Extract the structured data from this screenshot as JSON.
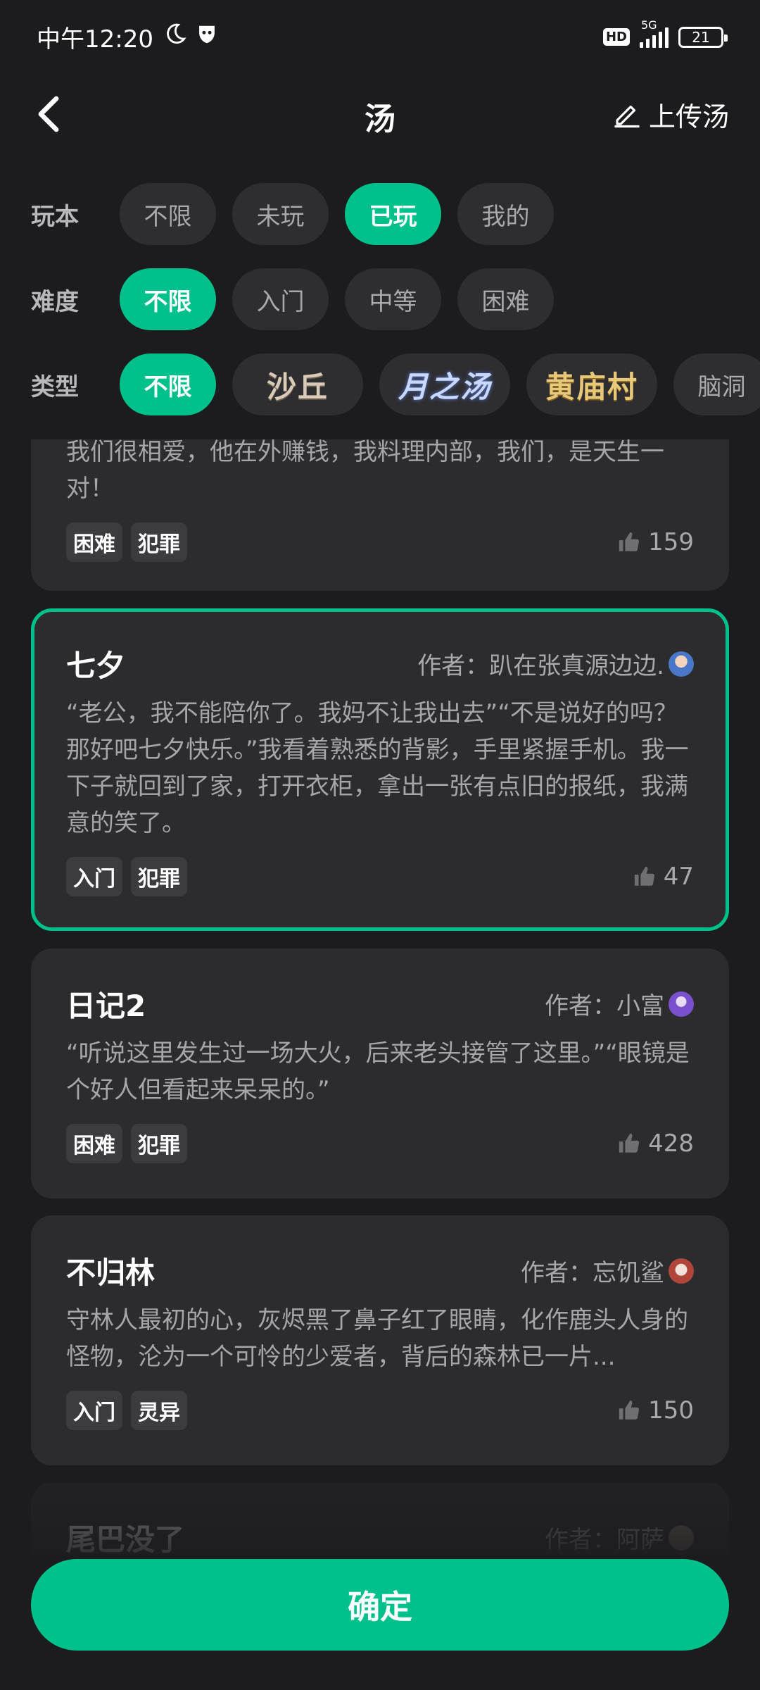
{
  "status_bar": {
    "time": "中午12:20",
    "hd": "HD",
    "network": "5G",
    "battery": "21"
  },
  "header": {
    "title": "汤",
    "upload_label": "上传汤"
  },
  "filters": {
    "play": {
      "label": "玩本",
      "options": [
        "不限",
        "未玩",
        "已玩",
        "我的"
      ],
      "selected": "已玩"
    },
    "difficulty": {
      "label": "难度",
      "options": [
        "不限",
        "入门",
        "中等",
        "困难"
      ],
      "selected": "不限"
    },
    "type": {
      "label": "类型",
      "options": [
        "不限",
        "沙丘",
        "月之汤",
        "黄庙村",
        "脑洞"
      ],
      "selected": "不限"
    }
  },
  "cards": [
    {
      "title": "",
      "author": "",
      "desc": "我们很相爱，他在外赚钱，我料理内部，我们，是天生一对！",
      "tags": [
        "困难",
        "犯罪"
      ],
      "likes": "159"
    },
    {
      "title": "七夕",
      "author": "作者：趴在张真源边边.",
      "desc": "“老公，我不能陪你了。我妈不让我出去”“不是说好的吗？那好吧七夕快乐。”我看着熟悉的背影，手里紧握手机。我一下子就回到了家，打开衣柜，拿出一张有点旧的报纸，我满意的笑了。",
      "tags": [
        "入门",
        "犯罪"
      ],
      "likes": "47",
      "selected": true
    },
    {
      "title": "日记2",
      "author": "作者：小富",
      "desc": "“听说这里发生过一场大火，后来老头接管了这里。”“眼镜是个好人但看起来呆呆的。”",
      "tags": [
        "困难",
        "犯罪"
      ],
      "likes": "428"
    },
    {
      "title": "不归林",
      "author": "作者：忘饥鲨",
      "desc": "守林人最初的心，灰烬黑了鼻子红了眼睛，化作鹿头人身的怪物，沦为一个可怜的少爱者，背后的森林已一片...",
      "tags": [
        "入门",
        "灵异"
      ],
      "likes": "150"
    },
    {
      "title": "尾巴没了",
      "author": "作者：阿萨",
      "desc": "",
      "tags": [],
      "likes": ""
    }
  ],
  "confirm_label": "确定",
  "colors": {
    "accent": "#00c08b",
    "background": "#1c1c1e",
    "card": "#2c2c2f"
  }
}
